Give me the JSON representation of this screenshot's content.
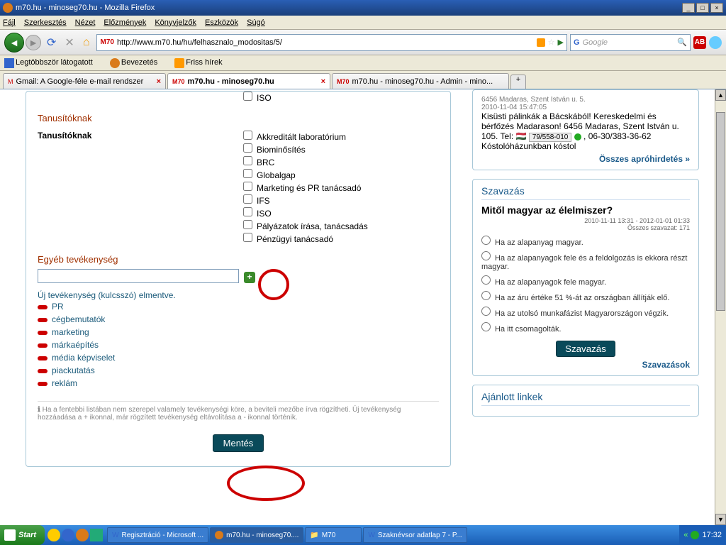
{
  "window": {
    "title": "m70.hu - minoseg70.hu - Mozilla Firefox",
    "minimize": "_",
    "maximize": "□",
    "close": "×"
  },
  "menu": {
    "file": "Fájl",
    "edit": "Szerkesztés",
    "view": "Nézet",
    "history": "Előzmények",
    "bookmarks": "Könyvjelzők",
    "tools": "Eszközök",
    "help": "Súgó"
  },
  "nav": {
    "url": "http://www.m70.hu/hu/felhasznalo_modositas/5/",
    "search_placeholder": "Google"
  },
  "bm": {
    "most": "Legtöbbször látogatott",
    "intro": "Bevezetés",
    "news": "Friss hírek"
  },
  "tabs": {
    "t1": "Gmail: A Google-féle e-mail rendszer",
    "t2": "m70.hu - minoseg70.hu",
    "t3": "m70.hu - minoseg70.hu - Admin - mino...",
    "favprefix": "M70"
  },
  "form": {
    "iso": "ISO",
    "sec1": "Tanusítóknak",
    "lbl1": "Tanusítóknak",
    "opts1": [
      "Akkreditált laboratórium",
      "Biominősítés",
      "BRC",
      "Globalgap",
      "Marketing és PR tanácsadó",
      "IFS",
      "ISO",
      "Pályázatok írása, tanácsadás",
      "Pénzügyi tanácsadó"
    ],
    "sec2": "Egyéb tevékenység",
    "saved": "Új tevékenység (kulcsszó) elmentve.",
    "keywords": [
      "PR",
      "cégbemutatók",
      "marketing",
      "márkaépítés",
      "média képviselet",
      "piackutatás",
      "reklám"
    ],
    "hint": "Ha a fentebbi listában nem szerepel valamely tevékenységi köre, a beviteli mezőbe írva rögzítheti. Új tevékenység hozzáadása a + ikonnal, már rögzített tevékenység eltávolítása a - ikonnal történik.",
    "save": "Mentés"
  },
  "ad": {
    "addr": "6456 Madaras, Szent István u. 5.",
    "date": "2010-11-04 15:47:05",
    "text": "Kisüsti pálinkák a Bácskából! Kereskedelmi és bérfőzés Madarason! 6456 Madaras, Szent István u. 105. Tel: ",
    "phone": "79/558-010",
    "text2": " , 06-30/383-36-62 Kóstolóházunkban kóstol",
    "all": "Összes apróhirdetés »"
  },
  "poll": {
    "heading": "Szavazás",
    "question": "Mitől magyar az élelmiszer?",
    "meta": "2010-11-11 13:31 - 2012-01-01 01:33",
    "total": "Összes szavazat: 171",
    "opts": [
      "Ha az alapanyag magyar.",
      "Ha az alapanyagok fele és a feldolgozás is ekkora részt magyar.",
      "Ha az alapanyagok fele magyar.",
      "Ha az áru értéke 51 %-át az országban állítják elő.",
      "Ha az utolsó munkafázist Magyarországon végzik.",
      "Ha itt csomagolták."
    ],
    "vote": "Szavazás",
    "results": "Szavazások"
  },
  "linkbox": {
    "heading": "Ajánlott linkek"
  },
  "taskbar": {
    "start": "Start",
    "items": [
      "Regisztráció - Microsoft ...",
      "m70.hu - minoseg70....",
      "M70",
      "Szaknévsor adatlap 7 - P..."
    ],
    "time": "17:32"
  }
}
